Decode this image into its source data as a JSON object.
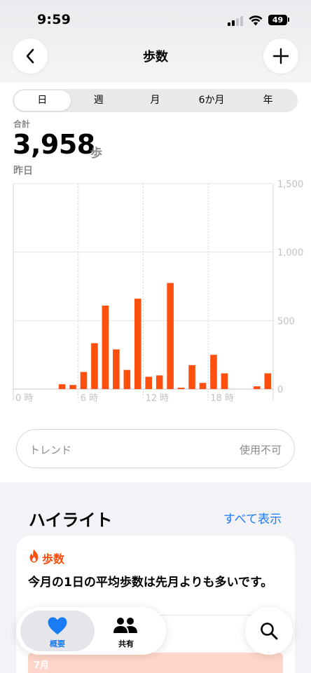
{
  "status_bar": {
    "time": "9:59",
    "battery": "49"
  },
  "nav": {
    "title": "歩数"
  },
  "segments": [
    {
      "label": "日",
      "active": true
    },
    {
      "label": "週",
      "active": false
    },
    {
      "label": "月",
      "active": false
    },
    {
      "label": "6か月",
      "active": false
    },
    {
      "label": "年",
      "active": false
    }
  ],
  "summary": {
    "label": "合計",
    "value": "3,958",
    "unit": "歩",
    "date": "昨日"
  },
  "chart_data": {
    "type": "bar",
    "x": [
      4,
      5,
      6,
      7,
      8,
      9,
      10,
      11,
      12,
      13,
      14,
      15,
      16,
      17,
      18,
      19,
      20,
      22,
      23
    ],
    "values": [
      35,
      30,
      125,
      335,
      610,
      290,
      140,
      660,
      90,
      100,
      775,
      10,
      175,
      45,
      250,
      115,
      0,
      20,
      115
    ],
    "xlim": [
      0,
      24
    ],
    "ylim": [
      0,
      1500
    ],
    "y_ticks": [
      0,
      500,
      "1,000",
      "1,500"
    ],
    "x_tick_labels": [
      "0 時",
      "6 時",
      "12 時",
      "18 時"
    ],
    "bar_color": "#ff4f0f",
    "grid": true
  },
  "trend": {
    "label": "トレンド",
    "status": "使用不可"
  },
  "highlights": {
    "title": "ハイライト",
    "show_all": "すべて表示",
    "card": {
      "category": "歩数",
      "text": "今月の1日の平均歩数は先月よりも多いです。",
      "month": "7月"
    }
  },
  "tabbar": {
    "summary": "概要",
    "sharing": "共有"
  },
  "colors": {
    "accent": "#ff4f0f",
    "link": "#1a7cf5"
  }
}
